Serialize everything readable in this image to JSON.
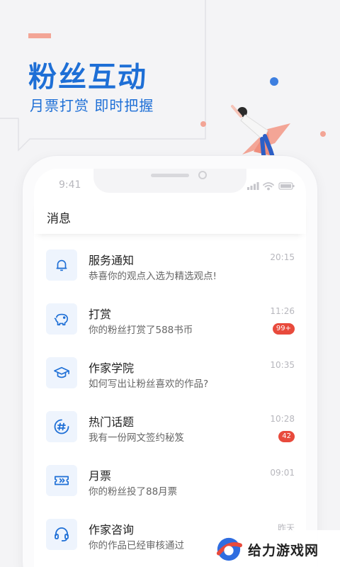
{
  "hero": {
    "title": "粉丝互动",
    "subtitle": "月票打赏  即时把握"
  },
  "phone": {
    "status_time": "9:41"
  },
  "messages": {
    "header": "消息",
    "items": [
      {
        "title": "服务通知",
        "subtitle": "恭喜你的观点入选为精选观点!",
        "time": "20:15",
        "badge": "",
        "icon": "bell-icon"
      },
      {
        "title": "打赏",
        "subtitle": "你的粉丝打赏了588书币",
        "time": "11:26",
        "badge": "99+",
        "icon": "piggy-bank-icon"
      },
      {
        "title": "作家学院",
        "subtitle": "如何写出让粉丝喜欢的作品?",
        "time": "10:35",
        "badge": "",
        "icon": "graduation-cap-icon"
      },
      {
        "title": "热门话题",
        "subtitle": "我有一份网文签约秘笈",
        "time": "10:28",
        "badge": "42",
        "icon": "hashtag-icon"
      },
      {
        "title": "月票",
        "subtitle": "你的粉丝投了88月票",
        "time": "09:01",
        "badge": "",
        "icon": "ticket-icon"
      },
      {
        "title": "作家咨询",
        "subtitle": "你的作品已经审核通过",
        "time": "昨天",
        "badge": "",
        "icon": "headset-icon"
      }
    ]
  },
  "watermark": {
    "text": "给力游戏网"
  },
  "colors": {
    "accent_blue": "#1e6fd6",
    "accent_pink": "#f3a596",
    "badge_red": "#e84a3c"
  }
}
